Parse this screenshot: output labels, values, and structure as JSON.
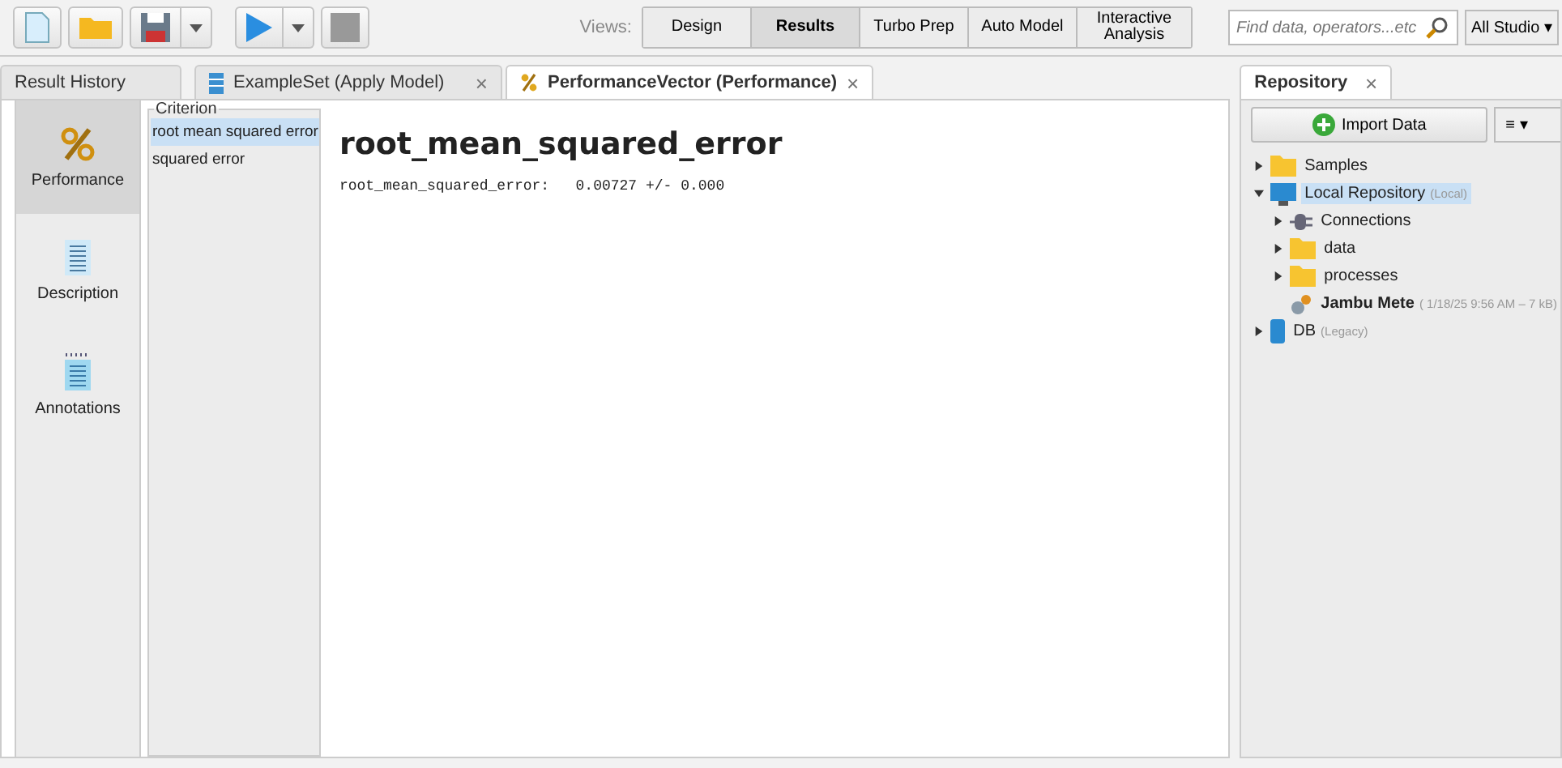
{
  "toolbar": {
    "views_label": "Views:",
    "views": [
      {
        "label": "Design",
        "selected": false
      },
      {
        "label": "Results",
        "selected": true
      },
      {
        "label": "Turbo Prep",
        "selected": false
      },
      {
        "label": "Auto Model",
        "selected": false
      },
      {
        "label": "Interactive Analysis",
        "selected": false
      }
    ],
    "search": {
      "placeholder": "Find data, operators...etc"
    },
    "scope": "All Studio ▾"
  },
  "tabs": [
    {
      "label": "Result History",
      "kind": "plain",
      "selected": false
    },
    {
      "label": "ExampleSet (Apply Model)",
      "kind": "table",
      "selected": false,
      "close": "×"
    },
    {
      "label": "PerformanceVector (Performance)",
      "kind": "performance",
      "selected": true,
      "close": "×"
    }
  ],
  "side_views": [
    {
      "label": "Performance",
      "kind": "percent",
      "selected": true
    },
    {
      "label": "Description",
      "kind": "text",
      "selected": false
    },
    {
      "label": "Annotations",
      "kind": "notes",
      "selected": false
    }
  ],
  "criterion": {
    "title": "Criterion",
    "items": [
      {
        "label": "root mean squared error",
        "selected": true
      },
      {
        "label": "squared error",
        "selected": false
      }
    ]
  },
  "result": {
    "heading": "root_mean_squared_error",
    "line": "root_mean_squared_error:   0.00727 +/- 0.000"
  },
  "repository": {
    "tab": "Repository",
    "close": "×",
    "import_button": "Import Data",
    "menu_button": "≡ ▾",
    "tree": [
      {
        "label": "Samples",
        "kind": "folder",
        "expanded": false,
        "selected": false
      },
      {
        "label": "Local Repository",
        "note": "(Local)",
        "kind": "repo",
        "expanded": true,
        "selected": true,
        "children": [
          {
            "label": "Connections",
            "kind": "connections",
            "expanded": false,
            "selected": false
          },
          {
            "label": "data",
            "kind": "folder",
            "expanded": false,
            "selected": false
          },
          {
            "label": "processes",
            "kind": "folder",
            "expanded": false,
            "selected": false
          },
          {
            "label": "Jambu Mete",
            "note": "( 1/18/25 9:56 AM – 7 kB)",
            "kind": "process",
            "selected": false
          }
        ]
      },
      {
        "label": "DB",
        "note": "(Legacy)",
        "kind": "db",
        "expanded": false,
        "selected": false
      }
    ]
  }
}
